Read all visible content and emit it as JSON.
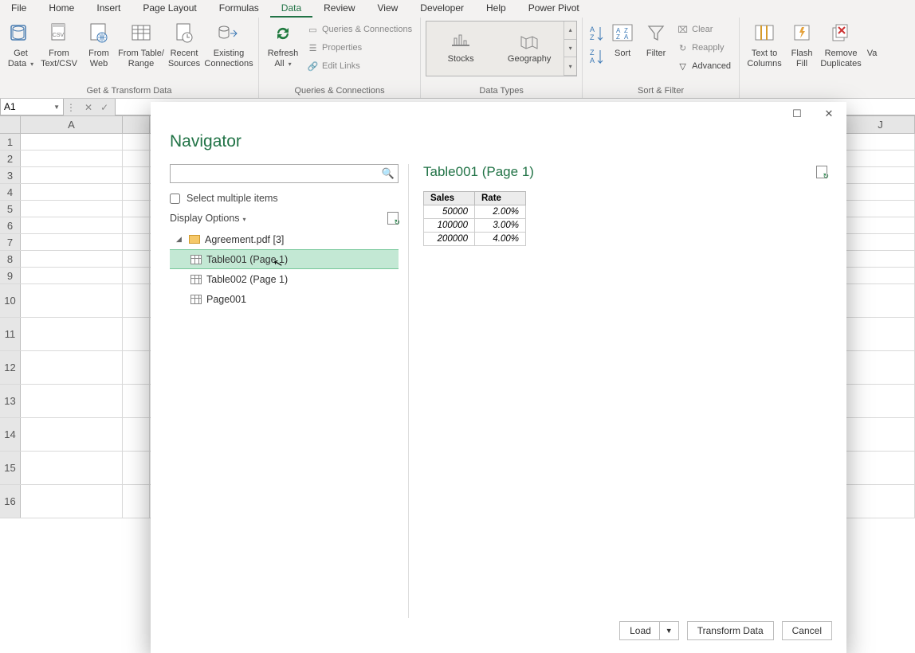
{
  "tabs": [
    "File",
    "Home",
    "Insert",
    "Page Layout",
    "Formulas",
    "Data",
    "Review",
    "View",
    "Developer",
    "Help",
    "Power Pivot"
  ],
  "active_tab": "Data",
  "ribbon": {
    "group_get_transform": {
      "label": "Get & Transform Data",
      "get_data": "Get\nData",
      "from_textcsv": "From\nText/CSV",
      "from_web": "From\nWeb",
      "from_table_range": "From Table/\nRange",
      "recent_sources": "Recent\nSources",
      "existing_connections": "Existing\nConnections"
    },
    "group_queries": {
      "label": "Queries & Connections",
      "refresh_all": "Refresh\nAll",
      "queries_connections": "Queries & Connections",
      "properties": "Properties",
      "edit_links": "Edit Links"
    },
    "group_datatypes": {
      "label": "Data Types",
      "stocks": "Stocks",
      "geography": "Geography"
    },
    "group_sortfilter": {
      "label": "Sort & Filter",
      "sort": "Sort",
      "filter": "Filter",
      "clear": "Clear",
      "reapply": "Reapply",
      "advanced": "Advanced"
    },
    "group_datatools": {
      "text_to_columns": "Text to\nColumns",
      "flash_fill": "Flash\nFill",
      "remove_duplicates": "Remove\nDuplicates",
      "validation": "Va"
    }
  },
  "namebox": "A1",
  "columns": [
    "A",
    "J"
  ],
  "dialog": {
    "title": "Navigator",
    "search_placeholder": "",
    "select_multiple": "Select multiple items",
    "display_options": "Display Options",
    "tree": {
      "root": "Agreement.pdf [3]",
      "items": [
        {
          "label": "Table001 (Page 1)",
          "selected": true,
          "type": "table"
        },
        {
          "label": "Table002 (Page 1)",
          "selected": false,
          "type": "table"
        },
        {
          "label": "Page001",
          "selected": false,
          "type": "page"
        }
      ]
    },
    "preview_title": "Table001 (Page 1)",
    "preview": {
      "headers": [
        "Sales",
        "Rate"
      ],
      "rows": [
        [
          "50000",
          "2.00%"
        ],
        [
          "100000",
          "3.00%"
        ],
        [
          "200000",
          "4.00%"
        ]
      ]
    },
    "footer": {
      "load": "Load",
      "transform": "Transform Data",
      "cancel": "Cancel"
    }
  }
}
